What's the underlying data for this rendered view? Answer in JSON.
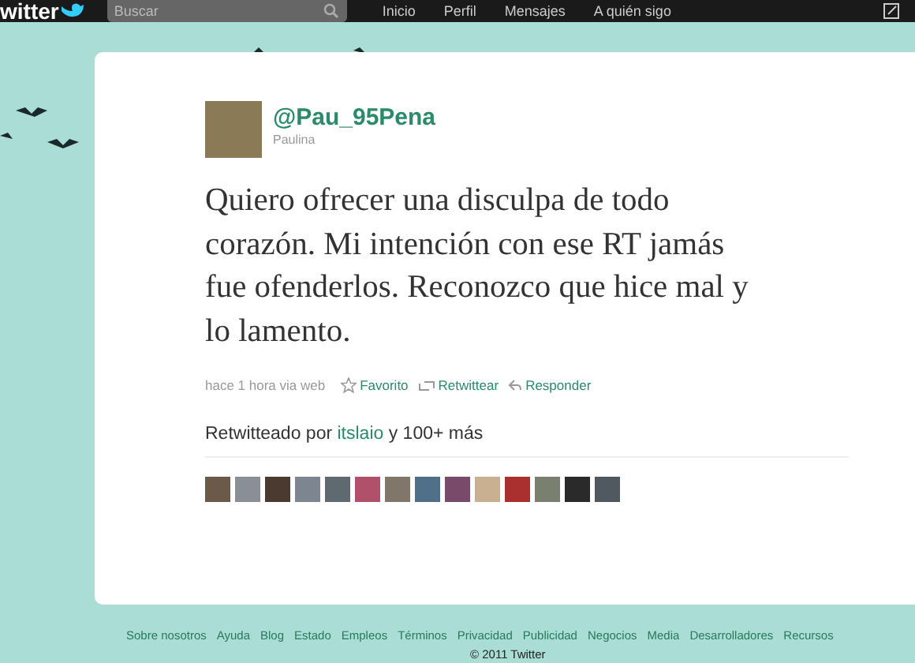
{
  "top_bar": {
    "logo": "witter",
    "search": {
      "placeholder": "Buscar"
    },
    "nav": [
      "Inicio",
      "Perfil",
      "Mensajes",
      "A quién sigo"
    ]
  },
  "tweet": {
    "username": "@Pau_95Pena",
    "name": "Paulina",
    "text": "Quiero ofrecer una disculpa de todo corazón. Mi intención con ese RT jamás fue ofenderlos. Reconozco que hice mal y lo lamento.",
    "time": "hace 1 hora via web",
    "actions": [
      {
        "kind": "favorite",
        "label": "Favorito"
      },
      {
        "kind": "retweet",
        "label": "Retwittear"
      },
      {
        "kind": "reply",
        "label": "Responder"
      }
    ],
    "retweeted": {
      "prefix": "Retwitteado por",
      "user": "itslaio",
      "suffix": "y 100+ más"
    }
  },
  "footer": {
    "links": [
      "Sobre nosotros",
      "Ayuda",
      "Blog",
      "Estado",
      "Empleos",
      "Términos",
      "Privacidad",
      "Publicidad",
      "Negocios",
      "Media",
      "Desarrolladores",
      "Recursos"
    ],
    "copyright": "© 2011 Twitter"
  }
}
